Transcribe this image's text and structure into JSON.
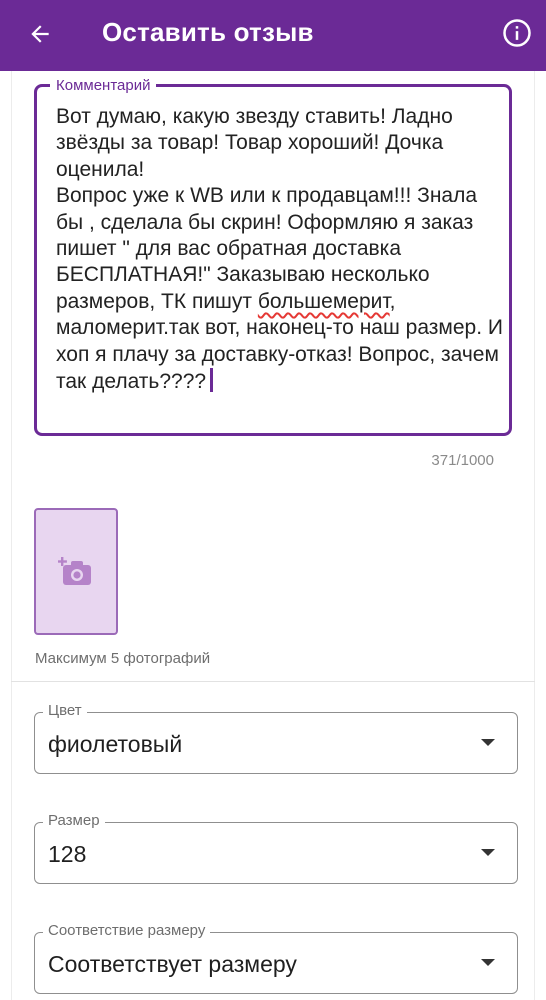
{
  "appbar": {
    "title": "Оставить отзыв",
    "back_icon": "arrow-left-icon",
    "info_icon": "info-circle-icon",
    "color": "#6b2a96"
  },
  "comment": {
    "label": "Комментарий",
    "text_before": "Вот думаю, какую звезду ставить! Ладно звёзды за товар! Товар хороший! Дочка оценила!\nВопрос уже к WB или к продавцам!!! Знала бы , сделала бы скрин! Оформляю я заказ пишет \" для вас обратная доставка БЕСПЛАТНАЯ!\" Заказываю несколько размеров, ТК пишут ",
    "misspelled_word": "большемерит",
    "text_after": ", маломерит.так вот, наконец-то наш размер. И хоп я плачу за доставку-отказ! Вопрос, зачем так делать????",
    "counter": "371/1000"
  },
  "photos": {
    "add_icon": "add-photo-camera-icon",
    "hint": "Максимум 5 фотографий"
  },
  "fields": {
    "color": {
      "label": "Цвет",
      "value": "фиолетовый"
    },
    "size": {
      "label": "Размер",
      "value": "128"
    },
    "fit": {
      "label": "Соответствие размеру",
      "value": "Соответствует размеру"
    }
  }
}
